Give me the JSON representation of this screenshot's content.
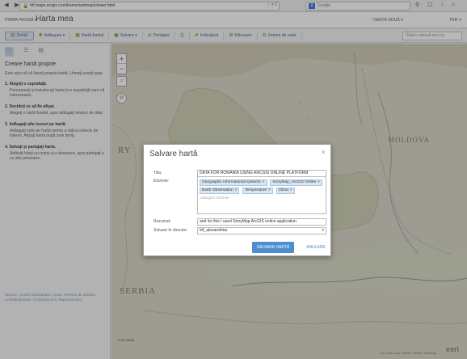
{
  "browser": {
    "url": "trif.maps.arcgis.com/home/webmap/viewer.html",
    "search_placeholder": "Google",
    "icons": [
      "back-icon",
      "forward-icon",
      "lock-icon",
      "star-icon",
      "home-icon",
      "menu-icon"
    ]
  },
  "app": {
    "home_label": "PRIMA PAGINĂ ▾",
    "title": "Harta mea",
    "user_label": "HARTĂ NOUĂ ▾",
    "help_label": "TRIF ▾"
  },
  "toolbar": {
    "details": "Detalii",
    "add": "Adăugare ▾",
    "basemap": "Hartă fundal",
    "save": "Salvare ▾",
    "share": "Partajare",
    "print": "",
    "directions": "Indicaţiuni",
    "measure": "Măsurare",
    "bookmarks": "Semne de carte",
    "search_placeholder": "Găsire adresă sau loc"
  },
  "sidebar": {
    "heading": "Creare hartă proprie",
    "intro": "Este uşor să vă faceţi propria hartă. Urmaţi aceşti paşi:",
    "steps": [
      {
        "title": "1. Alegeţi o suprafaţă.",
        "text": "Panoramaţi şi transfocaţi harta la o suprafaţă care vă interesează."
      },
      {
        "title": "2. Decideţi ce să fie afişat.",
        "text": "Alegeţi o hartă fundal, apoi adăugaţi straturi de date."
      },
      {
        "title": "3. Adăugaţi alte lucruri pe hartă.",
        "text": "Adăugaţi note pe hartă pentru a indica obiecte de interes. Afişaţi harta după cum doriţi."
      },
      {
        "title": "4. Salvaţi şi partajaţi harta.",
        "text": "Atribuiţi hărţii un nume şi o descriere, apoi partajaţi-o cu alte persoane."
      }
    ],
    "footer": "Servicii, ArcGIS Marketplace, Ajutor, Termeni de utilizare, Confidenţialitate, Contactaţi Esri, Raportaţi abuz"
  },
  "map": {
    "labels": [
      "MOLDOVA",
      "SERBIA",
      "RY"
    ],
    "scale_text": "0        50       100mi",
    "attribution": "Esri, DeLorme, HERE, USGS, Intermap",
    "logo": "esri"
  },
  "dialog": {
    "title": "Salvare hartă",
    "title_label": "Titlu:",
    "title_value": "DATA FOR ROMANIA USING ARCGIS ONLINE PLATFORM",
    "tags_label": "Etichete:",
    "tags": [
      "Geographic Informational systems",
      "StoryMap_ArcGIS Online",
      "Earth Observation",
      "Temperature",
      "Clima"
    ],
    "tags_placeholder": "Adăugare etichete",
    "summary_label": "Rezumat:",
    "summary_value": "and for this I used StoryMap ArcGIS online application",
    "folder_label": "Salvare în director:",
    "folder_value": "trif_alexandrina",
    "save_button": "SALVARE HARTĂ",
    "cancel_button": "ANULARE"
  }
}
